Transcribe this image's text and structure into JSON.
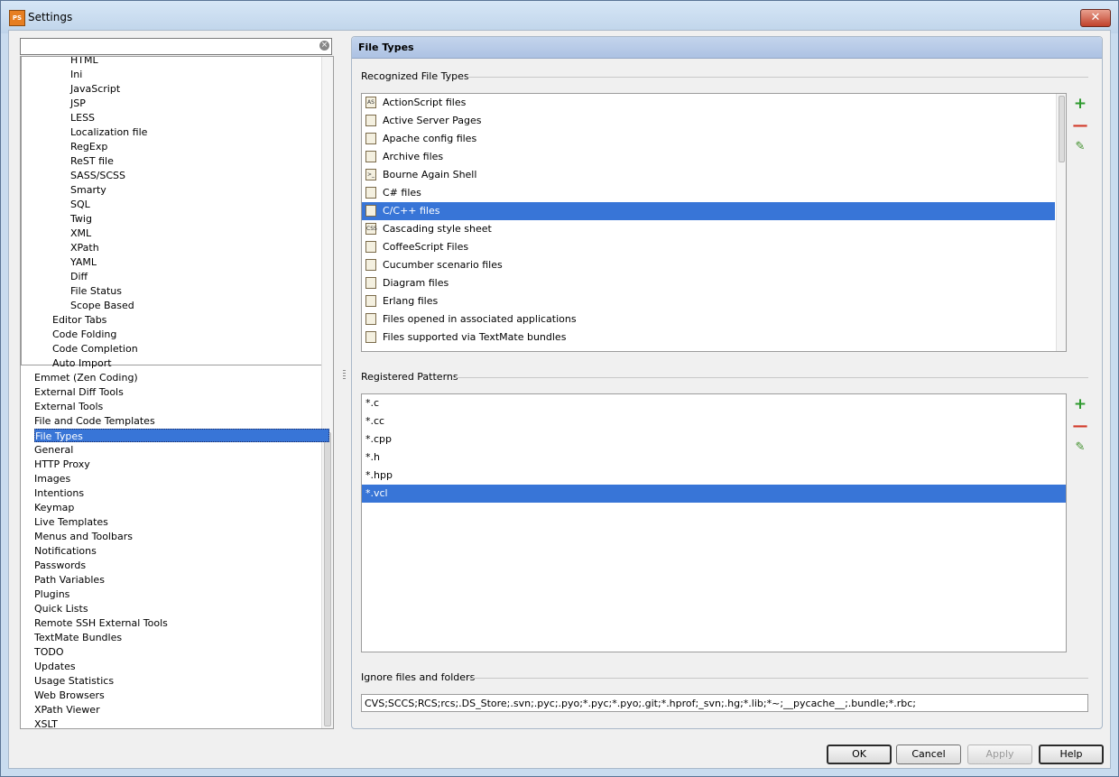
{
  "window": {
    "title": "Settings",
    "close_glyph": "✕",
    "app_icon": "PhpStorm"
  },
  "search": {
    "value": ""
  },
  "tree": {
    "nested_items": [
      "HTML",
      "Ini",
      "JavaScript",
      "JSP",
      "LESS",
      "Localization file",
      "RegExp",
      "ReST file",
      "SASS/SCSS",
      "Smarty",
      "SQL",
      "Twig",
      "XML",
      "XPath",
      "YAML",
      "Diff",
      "File Status",
      "Scope Based"
    ],
    "editor_items": [
      "Editor Tabs",
      "Code Folding",
      "Code Completion",
      "Auto Import"
    ],
    "top_items": [
      "Emmet (Zen Coding)",
      "External Diff Tools",
      "External Tools",
      "File and Code Templates",
      "File Types",
      "General",
      "HTTP Proxy",
      "Images",
      "Intentions",
      "Keymap",
      "Live Templates",
      "Menus and Toolbars",
      "Notifications",
      "Passwords",
      "Path Variables",
      "Plugins",
      "Quick Lists",
      "Remote SSH External Tools",
      "TextMate Bundles",
      "TODO",
      "Updates",
      "Usage Statistics",
      "Web Browsers",
      "XPath Viewer",
      "XSLT"
    ],
    "selected": "File Types"
  },
  "panel": {
    "title": "File Types",
    "recognized_label": "Recognized File Types",
    "patterns_label": "Registered Patterns",
    "ignore_label": "Ignore files and folders",
    "ignore_value": "CVS;SCCS;RCS;rcs;.DS_Store;.svn;.pyc;.pyo;*.pyc;*.pyo;.git;*.hprof;_svn;.hg;*.lib;*~;__pycache__;.bundle;*.rbc;"
  },
  "file_types": [
    {
      "label": "ActionScript files",
      "icon": "actionscript-icon",
      "glyph": "AS"
    },
    {
      "label": "Active Server Pages",
      "icon": "asp-icon",
      "glyph": ""
    },
    {
      "label": "Apache config files",
      "icon": "apache-icon",
      "glyph": ""
    },
    {
      "label": "Archive files",
      "icon": "archive-icon",
      "glyph": ""
    },
    {
      "label": "Bourne Again Shell",
      "icon": "shell-icon",
      "glyph": ">_"
    },
    {
      "label": "C# files",
      "icon": "csharp-icon",
      "glyph": ""
    },
    {
      "label": "C/C++ files",
      "icon": "cpp-icon",
      "glyph": ""
    },
    {
      "label": "Cascading style sheet",
      "icon": "css-icon",
      "glyph": "CSS"
    },
    {
      "label": "CoffeeScript Files",
      "icon": "coffeescript-icon",
      "glyph": ""
    },
    {
      "label": "Cucumber scenario files",
      "icon": "cucumber-icon",
      "glyph": ""
    },
    {
      "label": "Diagram files",
      "icon": "diagram-icon",
      "glyph": ""
    },
    {
      "label": "Erlang files",
      "icon": "erlang-icon",
      "glyph": ""
    },
    {
      "label": "Files opened in associated applications",
      "icon": "associated-app-icon",
      "glyph": ""
    },
    {
      "label": "Files supported via TextMate bundles",
      "icon": "textmate-icon",
      "glyph": ""
    }
  ],
  "file_types_selected": "C/C++ files",
  "patterns": [
    "*.c",
    "*.cc",
    "*.cpp",
    "*.h",
    "*.hpp",
    "*.vcl"
  ],
  "patterns_selected": "*.vcl",
  "tool_glyphs": {
    "add": "+",
    "remove": "—",
    "edit": "✎"
  },
  "buttons": {
    "ok": "OK",
    "cancel": "Cancel",
    "apply": "Apply",
    "help": "Help"
  },
  "colors": {
    "selection": "#3875d7",
    "header": "#b5c8e6"
  }
}
